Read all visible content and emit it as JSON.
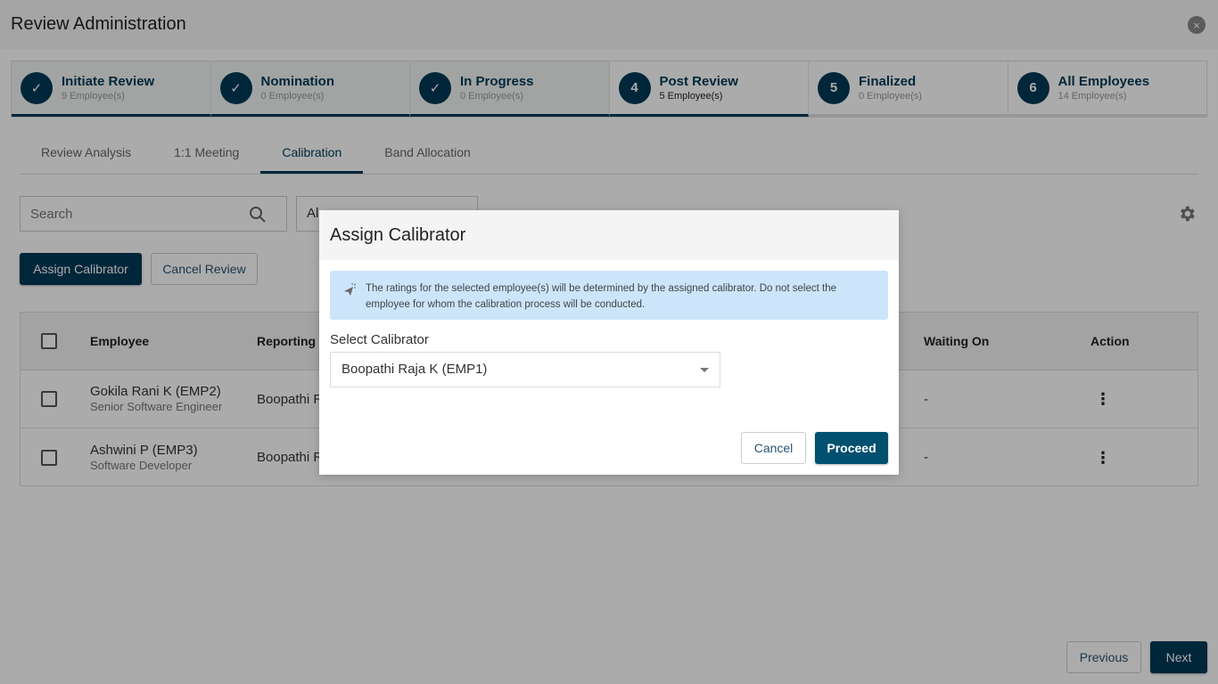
{
  "header": {
    "title": "Review Administration",
    "close_icon": "×"
  },
  "stepper": [
    {
      "marker": "✓",
      "label": "Initiate Review",
      "count": "9 Employee(s)",
      "state": "done"
    },
    {
      "marker": "✓",
      "label": "Nomination",
      "count": "0 Employee(s)",
      "state": "done"
    },
    {
      "marker": "✓",
      "label": "In Progress",
      "count": "0 Employee(s)",
      "state": "done"
    },
    {
      "marker": "4",
      "label": "Post Review",
      "count": "5 Employee(s)",
      "state": "active"
    },
    {
      "marker": "5",
      "label": "Finalized",
      "count": "0 Employee(s)",
      "state": "pending"
    },
    {
      "marker": "6",
      "label": "All Employees",
      "count": "14 Employee(s)",
      "state": "pending"
    }
  ],
  "tabs": [
    {
      "label": "Review Analysis",
      "active": false
    },
    {
      "label": "1:1 Meeting",
      "active": false
    },
    {
      "label": "Calibration",
      "active": true
    },
    {
      "label": "Band Allocation",
      "active": false
    }
  ],
  "filters": {
    "search_placeholder": "Search",
    "filter_value": "Al"
  },
  "actions": {
    "assign_label": "Assign Calibrator",
    "cancel_review_label": "Cancel Review"
  },
  "table": {
    "headers": {
      "employee": "Employee",
      "reporting": "Reporting",
      "waiting_on": "Waiting On",
      "action": "Action"
    },
    "rows": [
      {
        "name": "Gokila Rani K (EMP2)",
        "role": "Senior Software Engineer",
        "reporting": "Boopathi R",
        "waiting_on": "-",
        "action_icon": "⋮"
      },
      {
        "name": "Ashwini P (EMP3)",
        "role": "Software Developer",
        "reporting": "Boopathi R",
        "waiting_on": "-",
        "action_icon": "⋮"
      }
    ]
  },
  "pagination": {
    "previous_label": "Previous",
    "next_label": "Next"
  },
  "modal": {
    "title": "Assign Calibrator",
    "info_text": "The ratings for the selected employee(s) will be determined by the assigned calibrator. Do not select the employee for whom the calibration process will be conducted.",
    "select_label": "Select Calibrator",
    "selected_calibrator": "Boopathi Raja K (EMP1)",
    "cancel_label": "Cancel",
    "proceed_label": "Proceed"
  },
  "colors": {
    "brand": "#003a57",
    "info_bg": "#cce5fb",
    "proceed_bg": "#01506f"
  }
}
